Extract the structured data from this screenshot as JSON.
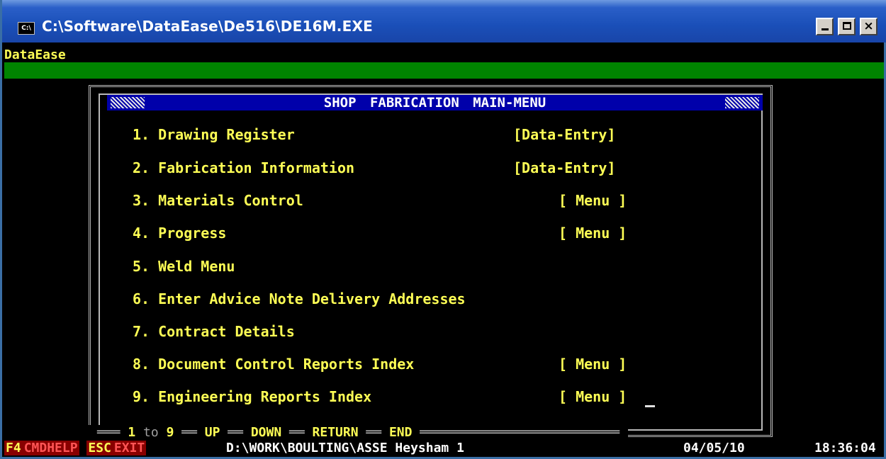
{
  "window": {
    "title": "C:\\Software\\DataEase\\De516\\DE16M.EXE",
    "icon_label": "C:\\",
    "minimize": "_",
    "maximize": "□",
    "close": "×"
  },
  "app_label": "DataEase",
  "menu": {
    "title": "SHOP FABRICATION  MAIN-MENU",
    "items": [
      {
        "num": "1.",
        "label": "Drawing Register",
        "tag": "[Data-Entry]"
      },
      {
        "num": "2.",
        "label": "Fabrication Information",
        "tag": "[Data-Entry]"
      },
      {
        "num": "3.",
        "label": "Materials Control",
        "tag": "[ Menu ]"
      },
      {
        "num": "4.",
        "label": "Progress",
        "tag": "[ Menu ]"
      },
      {
        "num": "5.",
        "label": "Weld Menu",
        "tag": ""
      },
      {
        "num": "6.",
        "label": "Enter Advice Note Delivery Addresses",
        "tag": ""
      },
      {
        "num": "7.",
        "label": "Contract Details",
        "tag": ""
      },
      {
        "num": "8.",
        "label": "Document Control Reports Index",
        "tag": "[ Menu ]"
      },
      {
        "num": "9.",
        "label": "Engineering Reports Index",
        "tag": "[ Menu ]"
      }
    ]
  },
  "nav_hint": {
    "range_start": "1",
    "range_to": "to",
    "range_end": "9",
    "up": "UP",
    "down": "DOWN",
    "return": "RETURN",
    "end": "END"
  },
  "status": {
    "f4_key": "F4",
    "f4_label": "CMDHELP",
    "esc_key": "ESC",
    "esc_label": "EXIT",
    "path": "D:\\WORK\\BOULTING\\ASSE Heysham 1",
    "date": "04/05/10",
    "time": "18:36:04"
  },
  "colors": {
    "menu_text": "#ffff55",
    "header_bg": "#0000aa",
    "green_bar": "#008400",
    "status_key_bg": "#880000"
  }
}
